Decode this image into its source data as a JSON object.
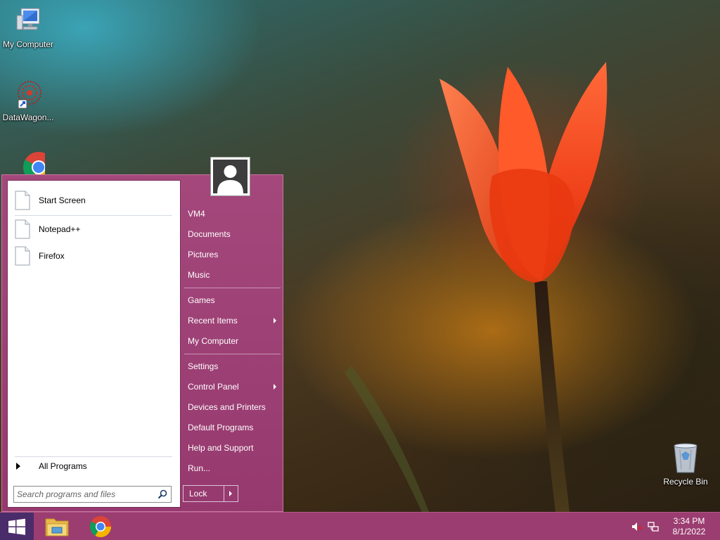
{
  "desktop": {
    "icons": [
      {
        "label": "My Computer",
        "icon": "computer-icon"
      },
      {
        "label": "DataWagon...",
        "icon": "datawagon-icon"
      },
      {
        "label": "",
        "icon": "chrome-icon"
      },
      {
        "label": "Recycle Bin",
        "icon": "recycle-bin-icon"
      }
    ]
  },
  "start_menu": {
    "pinned": [
      {
        "label": "Start Screen",
        "icon": "document-icon"
      }
    ],
    "recent": [
      {
        "label": "Notepad++",
        "icon": "document-icon"
      },
      {
        "label": "Firefox",
        "icon": "document-icon"
      }
    ],
    "all_programs_label": "All Programs",
    "search": {
      "placeholder": "Search programs and files",
      "value": ""
    },
    "right_items": [
      {
        "label": "VM4",
        "submenu": false
      },
      {
        "label": "Documents",
        "submenu": false
      },
      {
        "label": "Pictures",
        "submenu": false
      },
      {
        "label": "Music",
        "submenu": false
      },
      {
        "label": "Games",
        "submenu": false
      },
      {
        "label": "Recent Items",
        "submenu": true
      },
      {
        "label": "My Computer",
        "submenu": false
      },
      {
        "label": "Settings",
        "submenu": false
      },
      {
        "label": "Control Panel",
        "submenu": true
      },
      {
        "label": "Devices and Printers",
        "submenu": false
      },
      {
        "label": "Default Programs",
        "submenu": false
      },
      {
        "label": "Help and Support",
        "submenu": false
      },
      {
        "label": "Run...",
        "submenu": false
      }
    ],
    "lock_label": "Lock"
  },
  "taskbar": {
    "apps": [
      {
        "icon": "file-explorer-icon"
      },
      {
        "icon": "chrome-icon"
      }
    ],
    "tray": [
      {
        "icon": "volume-muted-icon"
      },
      {
        "icon": "network-icon"
      }
    ],
    "clock": {
      "time": "3:34 PM",
      "date": "8/1/2022"
    }
  },
  "colors": {
    "start_menu_bg": "#a4487c",
    "taskbar_bg": "#9b3d70",
    "start_button_bg": "#4a2c6a"
  }
}
